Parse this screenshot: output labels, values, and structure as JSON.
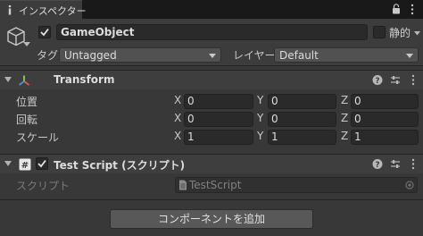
{
  "window": {
    "tab_title": "インスペクター",
    "icons": {
      "tab": "info-icon",
      "lock": "lock-icon",
      "menu": "kebab-menu-icon"
    }
  },
  "gameobject": {
    "active": true,
    "name": "GameObject",
    "static_label": "静的",
    "static_checked": false,
    "tag_label": "タグ",
    "tag_value": "Untagged",
    "layer_label": "レイヤー",
    "layer_value": "Default"
  },
  "transform": {
    "title": "Transform",
    "rows": [
      {
        "label": "位置",
        "x": "0",
        "y": "0",
        "z": "0"
      },
      {
        "label": "回転",
        "x": "0",
        "y": "0",
        "z": "0"
      },
      {
        "label": "スケール",
        "x": "1",
        "y": "1",
        "z": "1"
      }
    ],
    "axes": {
      "x": "X",
      "y": "Y",
      "z": "Z"
    }
  },
  "test_script": {
    "enabled": true,
    "title": "Test Script (スクリプト)",
    "script_label": "スクリプト",
    "script_value": "TestScript"
  },
  "add_component_label": "コンポーネントを追加",
  "colors": {
    "background": "#383838",
    "header": "#3e3e3e",
    "field": "#2a2a2a",
    "transform_icon_red": "#e0584a",
    "transform_icon_green": "#8fd14f",
    "transform_icon_blue": "#4a8fe0"
  }
}
